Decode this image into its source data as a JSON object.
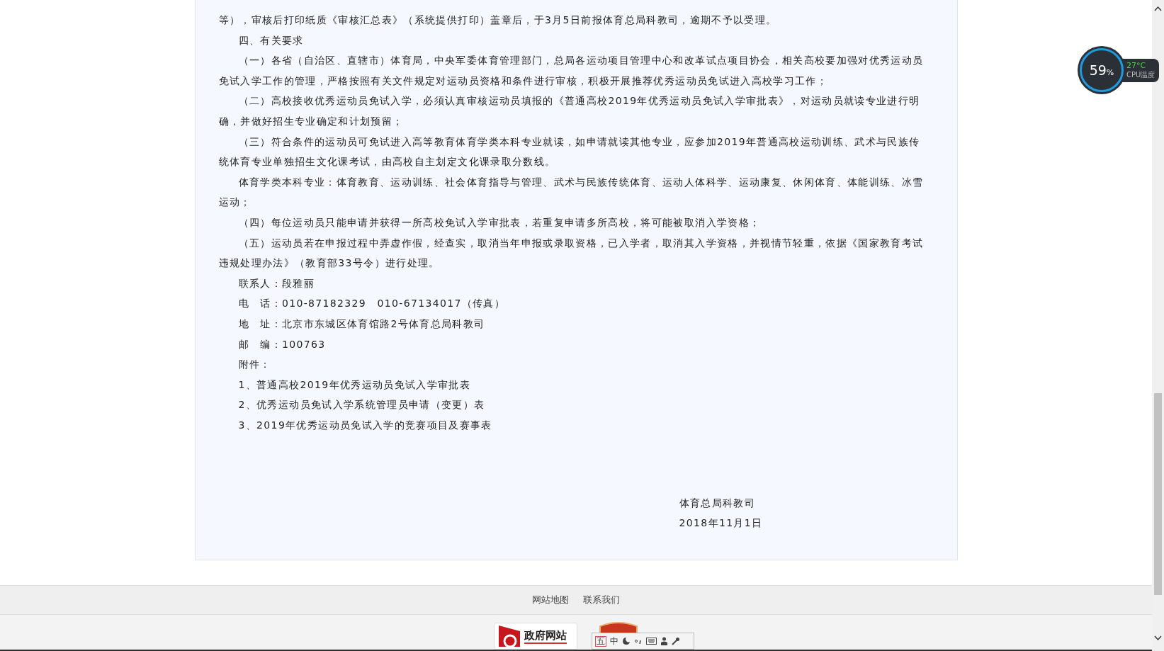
{
  "article": {
    "paragraphs": [
      {
        "kind": "continuation",
        "text": "等），审核后打印纸质《审核汇总表》（系统提供打印）盖章后，于3月5日前报体育总局科教司，逾期不予以受理。"
      },
      {
        "kind": "paragraph",
        "text": "四、有关要求"
      },
      {
        "kind": "paragraph",
        "text": "（一）各省（自治区、直辖市）体育局，中央军委体育管理部门，总局各运动项目管理中心和改革试点项目协会，相关高校要加强对优秀运动员免试入学工作的管理，严格按照有关文件规定对运动员资格和条件进行审核，积极开展推荐优秀运动员免试进入高校学习工作；"
      },
      {
        "kind": "paragraph",
        "text": "（二）高校接收优秀运动员免试入学，必须认真审核运动员填报的《普通高校2019年优秀运动员免试入学审批表》，对运动员就读专业进行明确，并做好招生专业确定和计划预留；"
      },
      {
        "kind": "paragraph",
        "text": "（三）符合条件的运动员可免试进入高等教育体育学类本科专业就读，如申请就读其他专业，应参加2019年普通高校运动训练、武术与民族传统体育专业单独招生文化课考试，由高校自主划定文化课录取分数线。"
      },
      {
        "kind": "paragraph",
        "text": "体育学类本科专业：体育教育、运动训练、社会体育指导与管理、武术与民族传统体育、运动人体科学、运动康复、休闲体育、体能训练、冰雪运动；"
      },
      {
        "kind": "paragraph",
        "text": "（四）每位运动员只能申请并获得一所高校免试入学审批表，若重复申请多所高校，将可能被取消入学资格；"
      },
      {
        "kind": "paragraph",
        "text": "（五）运动员若在申报过程中弄虚作假，经查实，取消当年申报或录取资格，已入学者，取消其入学资格，并视情节轻重，依据《国家教育考试违规处理办法》（教育部33号令）进行处理。"
      },
      {
        "kind": "paragraph",
        "text": "联系人：段雅丽"
      },
      {
        "kind": "paragraph",
        "text": "电　话：010-87182329　010-67134017（传真）"
      },
      {
        "kind": "paragraph",
        "text": "地　址：北京市东城区体育馆路2号体育总局科教司"
      },
      {
        "kind": "paragraph",
        "text": "邮　编：100763"
      },
      {
        "kind": "paragraph",
        "text": "附件："
      },
      {
        "kind": "paragraph",
        "text": "1、普通高校2019年优秀运动员免试入学审批表"
      },
      {
        "kind": "paragraph",
        "text": "2、优秀运动员免试入学系统管理员申请（变更）表"
      },
      {
        "kind": "paragraph",
        "text": "3、2019年优秀运动员免试入学的竞赛项目及赛事表"
      }
    ],
    "signature": {
      "org": "体育总局科教司",
      "date": "2018年11月1日"
    }
  },
  "footer": {
    "links": [
      "网站地图",
      "联系我们"
    ],
    "badge": "政府网站"
  },
  "ime_toolbar": {
    "items": [
      "五",
      "中"
    ]
  },
  "cpu_widget": {
    "percent": "59",
    "unit": "%",
    "temperature": "27°C",
    "label": "CPU温度"
  }
}
